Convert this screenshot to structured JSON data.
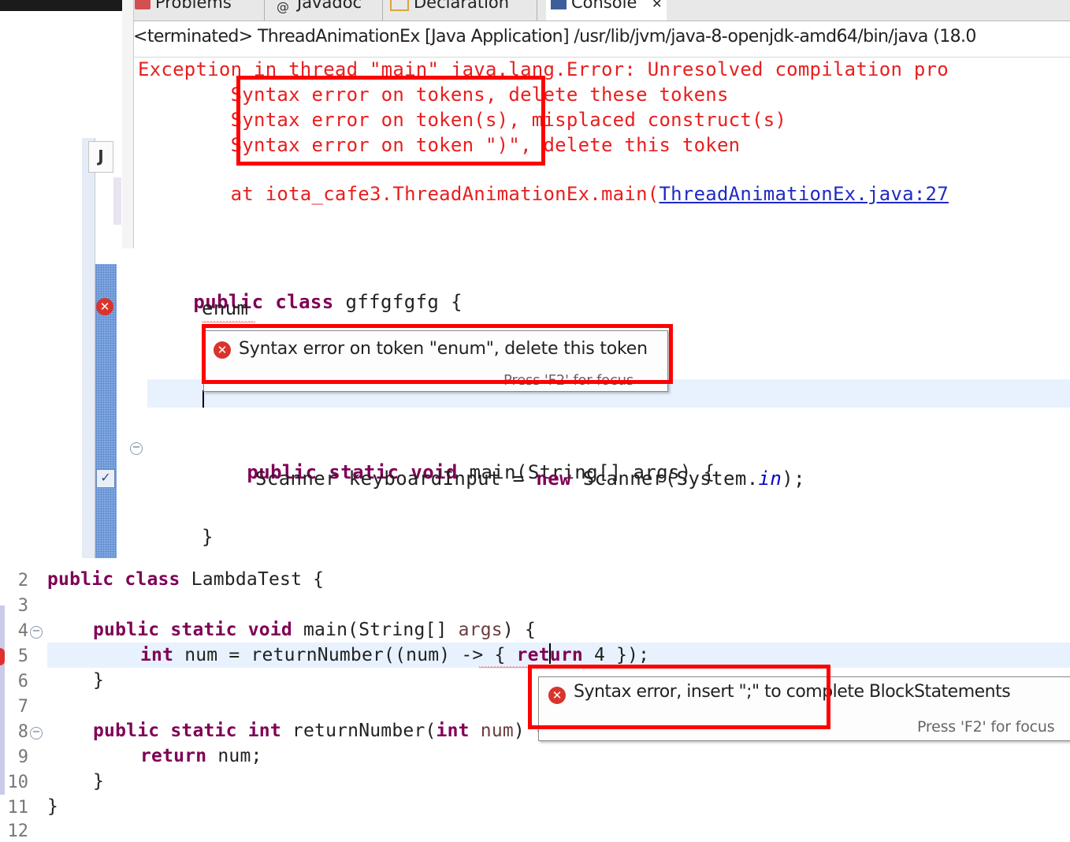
{
  "console": {
    "tabs": [
      "Problems",
      "Javadoc",
      "Declaration",
      "Console"
    ],
    "description": "<terminated> ThreadAnimationEx [Java Application] /usr/lib/jvm/java-8-openjdk-amd64/bin/java (18.0",
    "output_lines": [
      "Exception in thread \"main\" java.lang.Error: Unresolved compilation pro",
      "        Syntax error on tokens, delete these tokens",
      "        Syntax error on token(s), misplaced construct(s)",
      "        Syntax error on token \")\", delete this token",
      "",
      "        at iota_cafe3.ThreadAnimationEx.main("
    ],
    "link_text": "ThreadAnimationEx.java:27"
  },
  "editor_enum": {
    "lines": [
      "public class gffgfgfg {",
      "enum",
      "public static void main(String[] args) {",
      "Scanner keyboardInput = new Scanner(System.in);",
      "}"
    ],
    "tooltip_message": "Syntax error on token \"enum\", delete this token",
    "tooltip_hint": "Press 'F2' for focus"
  },
  "editor_lambda": {
    "line_numbers": [
      "2",
      "3",
      "4",
      "5",
      "6",
      "7",
      "8",
      "9",
      "10",
      "11",
      "12"
    ],
    "tooltip_message": "Syntax error, insert \";\" to complete BlockStatements",
    "tooltip_hint": "Press 'F2' for focus"
  },
  "colors": {
    "highlight_box": "#ff0000",
    "error_text": "#e81e1e",
    "keyword": "#7f0055"
  }
}
